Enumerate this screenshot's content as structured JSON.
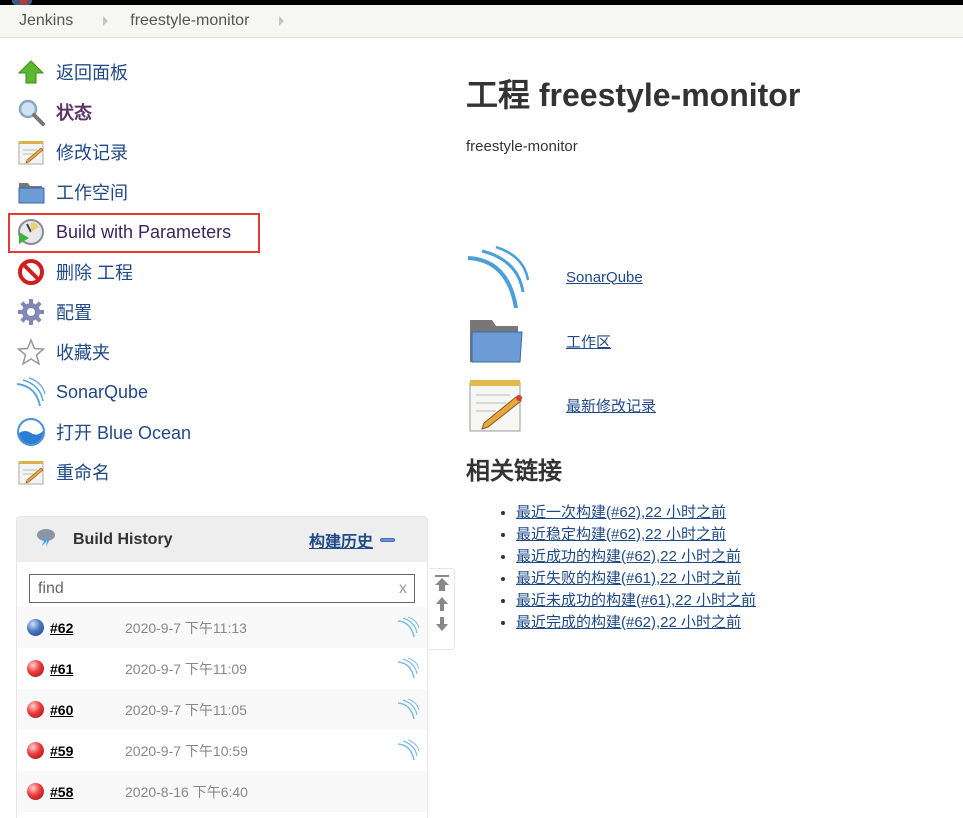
{
  "breadcrumb": [
    {
      "label": "Jenkins"
    },
    {
      "label": "freestyle-monitor"
    }
  ],
  "sidebar": {
    "items": [
      {
        "label": "返回面板",
        "icon": "up-arrow-icon"
      },
      {
        "label": "状态",
        "icon": "search-icon",
        "active": true
      },
      {
        "label": "修改记录",
        "icon": "notepad-icon"
      },
      {
        "label": "工作空间",
        "icon": "folder-icon"
      },
      {
        "label": "Build with Parameters",
        "icon": "clock-icon",
        "highlighted": true
      },
      {
        "label": "删除 工程",
        "icon": "no-entry-icon"
      },
      {
        "label": "配置",
        "icon": "gear-icon"
      },
      {
        "label": "收藏夹",
        "icon": "star-icon"
      },
      {
        "label": "SonarQube",
        "icon": "sonarqube-icon"
      },
      {
        "label": "打开 Blue Ocean",
        "icon": "blue-ocean-icon"
      },
      {
        "label": "重命名",
        "icon": "notepad-icon"
      }
    ]
  },
  "build_history": {
    "title": "Build History",
    "trend_label": "构建历史",
    "search_placeholder": "find",
    "clear_label": "x",
    "builds": [
      {
        "number": "#62",
        "date": "2020-9-7 下午11:13",
        "status": "blue",
        "sonar": true
      },
      {
        "number": "#61",
        "date": "2020-9-7 下午11:09",
        "status": "red",
        "sonar": true
      },
      {
        "number": "#60",
        "date": "2020-9-7 下午11:05",
        "status": "red",
        "sonar": true
      },
      {
        "number": "#59",
        "date": "2020-9-7 下午10:59",
        "status": "red",
        "sonar": true
      },
      {
        "number": "#58",
        "date": "2020-8-16 下午6:40",
        "status": "red",
        "sonar": false
      }
    ]
  },
  "main": {
    "title": "工程 freestyle-monitor",
    "description": "freestyle-monitor",
    "actions": [
      {
        "label": "SonarQube",
        "icon": "sonarqube-icon"
      },
      {
        "label": "工作区",
        "icon": "folder-icon"
      },
      {
        "label": "最新修改记录",
        "icon": "notepad-icon"
      }
    ],
    "related_title": "相关链接",
    "related_links": [
      {
        "label": "最近一次构建(#62),22 小时之前"
      },
      {
        "label": "最近稳定构建(#62),22 小时之前"
      },
      {
        "label": "最近成功的构建(#62),22 小时之前"
      },
      {
        "label": "最近失败的构建(#61),22 小时之前"
      },
      {
        "label": "最近未成功的构建(#61),22 小时之前"
      },
      {
        "label": "最近完成的构建(#62),22 小时之前"
      }
    ]
  },
  "colors": {
    "link": "#204a87",
    "highlight_border": "#e53935",
    "active_item": "#5c3566"
  }
}
